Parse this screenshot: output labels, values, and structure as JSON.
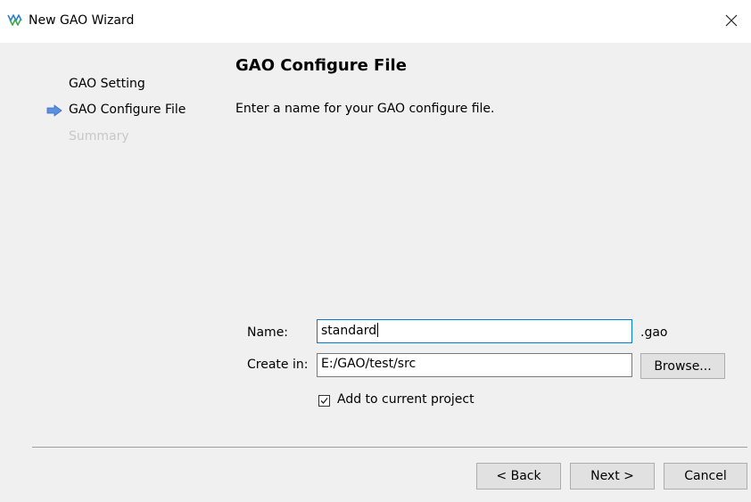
{
  "window": {
    "title": "New GAO Wizard",
    "close_glyph": "✕"
  },
  "steps": [
    {
      "label": "GAO Setting",
      "state": "done"
    },
    {
      "label": "GAO Configure File",
      "state": "current"
    },
    {
      "label": "Summary",
      "state": "pending"
    }
  ],
  "page": {
    "title": "GAO Configure File",
    "description": "Enter a name for your GAO configure file."
  },
  "form": {
    "name_label": "Name:",
    "name_value": "standard",
    "name_suffix": ".gao",
    "create_in_label": "Create in:",
    "create_in_value": "E:/GAO/test/src",
    "browse_label": "Browse...",
    "add_to_project_label": "Add to current project",
    "add_to_project_checked": true
  },
  "footer": {
    "back_label": "< Back",
    "next_label": "Next >",
    "cancel_label": "Cancel"
  },
  "colors": {
    "arrow": "#5b8fe0",
    "pending_step": "#c8c8c8",
    "focus_border": "#0078d7"
  }
}
